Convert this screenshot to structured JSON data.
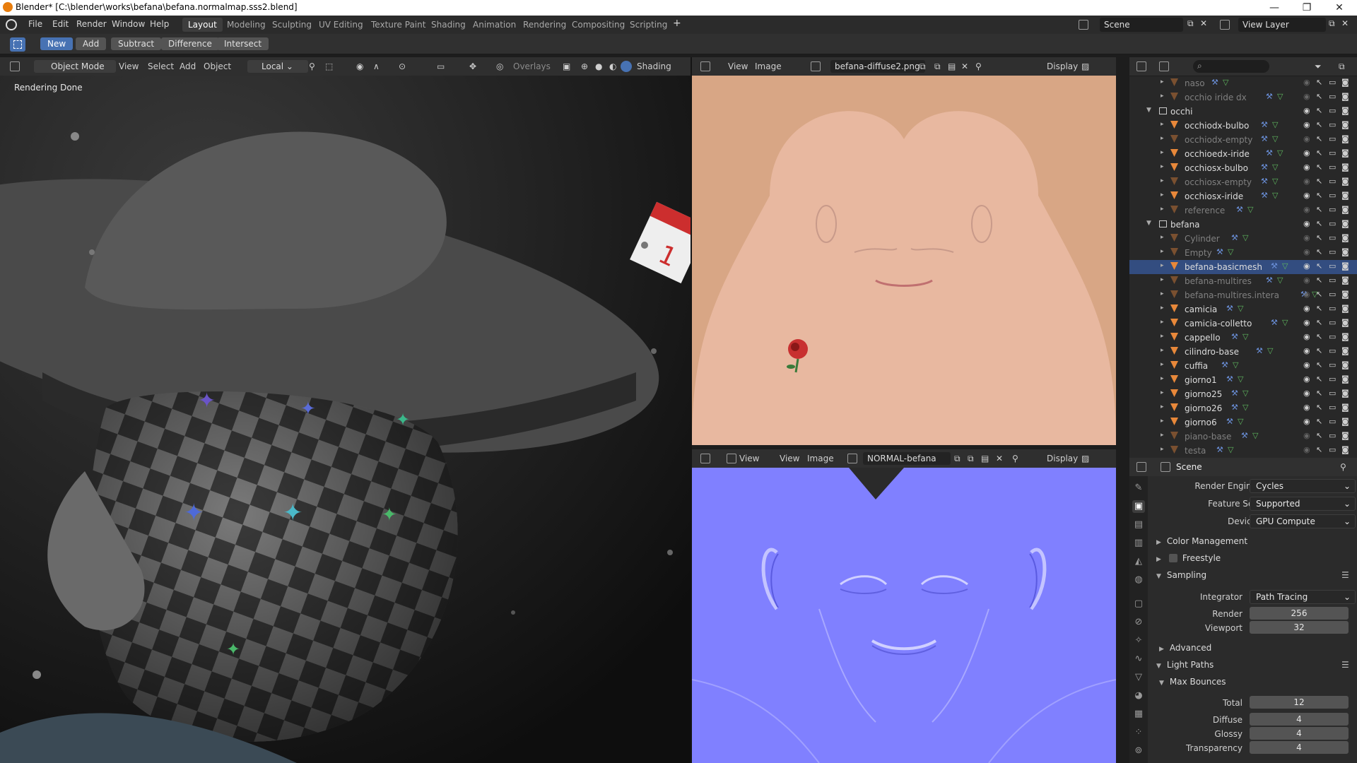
{
  "window": {
    "title": "Blender* [C:\\blender\\works\\befana\\befana.normalmap.sss2.blend]"
  },
  "menu": [
    "File",
    "Edit",
    "Render",
    "Window",
    "Help"
  ],
  "workspaces": [
    "Layout",
    "Modeling",
    "Sculpting",
    "UV Editing",
    "Texture Paint",
    "Shading",
    "Animation",
    "Rendering",
    "Compositing",
    "Scripting"
  ],
  "scene": {
    "name": "Scene",
    "view_layer": "View Layer"
  },
  "tool_header": {
    "buttons": [
      "New",
      "Add",
      "Subtract",
      "Difference",
      "Intersect"
    ]
  },
  "viewport": {
    "mode": "Object Mode",
    "menus": [
      "View",
      "Select",
      "Add",
      "Object"
    ],
    "orientation": "Local",
    "overlays": "Overlays",
    "shading": "Shading",
    "status": "Rendering Done"
  },
  "image_editor_top": {
    "menus": [
      "View",
      "Image"
    ],
    "image": "befana-diffuse2.png",
    "display": "Display"
  },
  "image_editor_bottom": {
    "menus": [
      "View",
      "View",
      "Image"
    ],
    "image": "NORMAL-befana",
    "display": "Display"
  },
  "outliner": {
    "rows": [
      {
        "label": "naso",
        "dim": true,
        "indent": 2
      },
      {
        "label": "occhio iride dx",
        "dim": true,
        "indent": 2
      },
      {
        "label": "occhi",
        "dim": false,
        "indent": 1,
        "collection": true
      },
      {
        "label": "occhiodx-bulbo",
        "dim": false,
        "indent": 2
      },
      {
        "label": "occhiodx-empty",
        "dim": true,
        "indent": 2
      },
      {
        "label": "occhioedx-iride",
        "dim": false,
        "indent": 2
      },
      {
        "label": "occhiosx-bulbo",
        "dim": false,
        "indent": 2
      },
      {
        "label": "occhiosx-empty",
        "dim": true,
        "indent": 2
      },
      {
        "label": "occhiosx-iride",
        "dim": false,
        "indent": 2
      },
      {
        "label": "reference",
        "dim": true,
        "indent": 2
      },
      {
        "label": "befana",
        "dim": false,
        "indent": 1,
        "collection": true
      },
      {
        "label": "Cylinder",
        "dim": true,
        "indent": 2
      },
      {
        "label": "Empty",
        "dim": true,
        "indent": 2
      },
      {
        "label": "befana-basicmesh",
        "dim": false,
        "indent": 2,
        "selected": true
      },
      {
        "label": "befana-multires",
        "dim": true,
        "indent": 2
      },
      {
        "label": "befana-multires.intera",
        "dim": true,
        "indent": 2
      },
      {
        "label": "camicia",
        "dim": false,
        "indent": 2
      },
      {
        "label": "camicia-colletto",
        "dim": false,
        "indent": 2
      },
      {
        "label": "cappello",
        "dim": false,
        "indent": 2
      },
      {
        "label": "cilindro-base",
        "dim": false,
        "indent": 2
      },
      {
        "label": "cuffia",
        "dim": false,
        "indent": 2
      },
      {
        "label": "giorno1",
        "dim": false,
        "indent": 2
      },
      {
        "label": "giorno25",
        "dim": false,
        "indent": 2
      },
      {
        "label": "giorno26",
        "dim": false,
        "indent": 2
      },
      {
        "label": "giorno6",
        "dim": false,
        "indent": 2
      },
      {
        "label": "piano-base",
        "dim": true,
        "indent": 2
      },
      {
        "label": "testa",
        "dim": true,
        "indent": 2
      }
    ]
  },
  "properties": {
    "context": "Scene",
    "render_engine_label": "Render Engine",
    "render_engine": "Cycles",
    "feature_set_label": "Feature Set",
    "feature_set": "Supported",
    "device_label": "Device",
    "device": "GPU Compute",
    "color_management": "Color Management",
    "freestyle": "Freestyle",
    "sampling": "Sampling",
    "integrator_label": "Integrator",
    "integrator": "Path Tracing",
    "render_label": "Render",
    "render_samples": "256",
    "viewport_label": "Viewport",
    "viewport_samples": "32",
    "advanced": "Advanced",
    "light_paths": "Light Paths",
    "max_bounces": "Max Bounces",
    "total_label": "Total",
    "total": "12",
    "diffuse_label": "Diffuse",
    "diffuse": "4",
    "glossy_label": "Glossy",
    "glossy": "4",
    "transparency_label": "Transparency",
    "transparency": "4"
  },
  "colors": {
    "accent": "#4772b3",
    "selected_row": "#334d80",
    "object_icon": "#e8883a",
    "diffuse_bg": "#d9a888",
    "normal_bg": "#8080ff"
  }
}
